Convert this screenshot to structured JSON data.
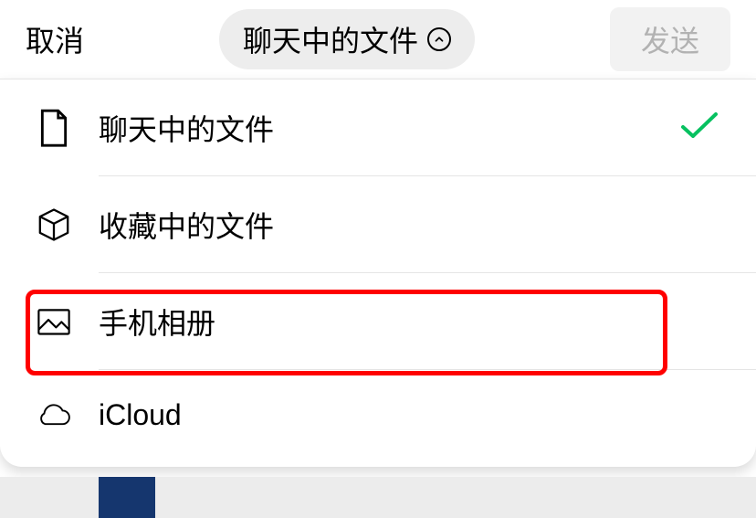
{
  "header": {
    "cancel": "取消",
    "title": "聊天中的文件",
    "send": "发送"
  },
  "options": [
    {
      "label": "聊天中的文件",
      "icon": "file",
      "selected": true
    },
    {
      "label": "收藏中的文件",
      "icon": "cube",
      "selected": false
    },
    {
      "label": "手机相册",
      "icon": "photo",
      "selected": false
    },
    {
      "label": "iCloud",
      "icon": "cloud",
      "selected": false
    }
  ],
  "highlight_index": 2,
  "colors": {
    "accent_green": "#07c160",
    "highlight_red": "#ff0000"
  }
}
